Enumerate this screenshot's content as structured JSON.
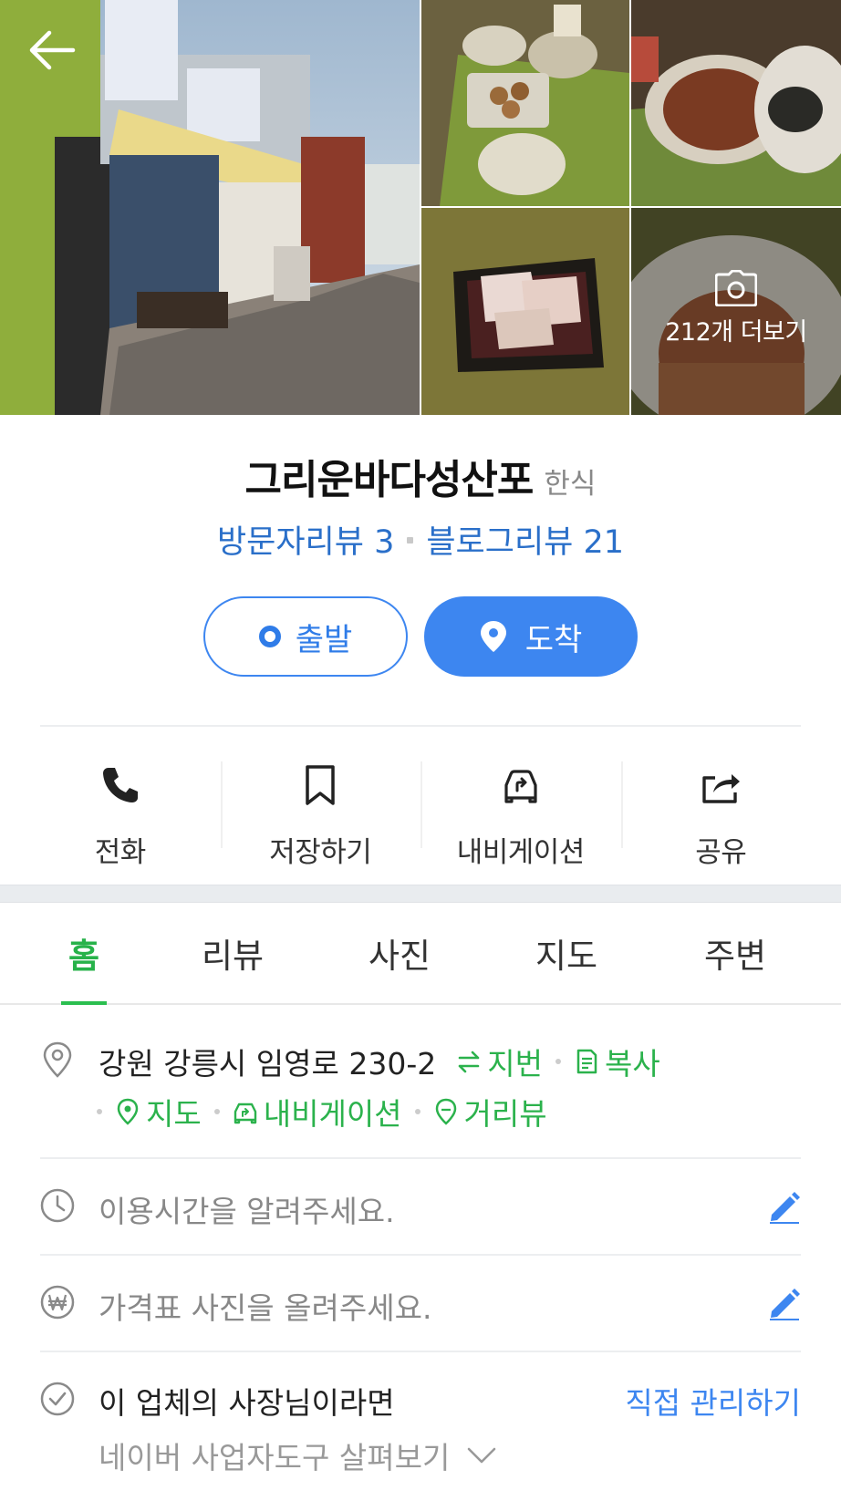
{
  "gallery": {
    "photo_count_label": "212개 더보기"
  },
  "place": {
    "name": "그리운바다성산포",
    "category": "한식",
    "visitor_reviews": "방문자리뷰 3",
    "blog_reviews": "블로그리뷰 21"
  },
  "route": {
    "start_label": "출발",
    "arrive_label": "도착"
  },
  "actions": [
    {
      "label": "전화",
      "icon": "phone-icon"
    },
    {
      "label": "저장하기",
      "icon": "bookmark-icon"
    },
    {
      "label": "내비게이션",
      "icon": "car-navigation-icon"
    },
    {
      "label": "공유",
      "icon": "share-icon"
    }
  ],
  "tabs": [
    {
      "label": "홈",
      "active": true
    },
    {
      "label": "리뷰",
      "active": false
    },
    {
      "label": "사진",
      "active": false
    },
    {
      "label": "지도",
      "active": false
    },
    {
      "label": "주변",
      "active": false
    }
  ],
  "address": {
    "text": "강원 강릉시 임영로 230-2",
    "lot_number_link": "지번",
    "copy_link": "복사",
    "map_link": "지도",
    "navigation_link": "내비게이션",
    "street_view_link": "거리뷰"
  },
  "hours": {
    "placeholder": "이용시간을 알려주세요."
  },
  "price": {
    "placeholder": "가격표 사진을 올려주세요."
  },
  "owner": {
    "text": "이 업체의 사장님이라면",
    "manage_link": "직접 관리하기",
    "tools_text": "네이버 사업자도구 살펴보기"
  },
  "colors": {
    "brand_green": "#2bb24c",
    "link_blue": "#3d86f0"
  }
}
